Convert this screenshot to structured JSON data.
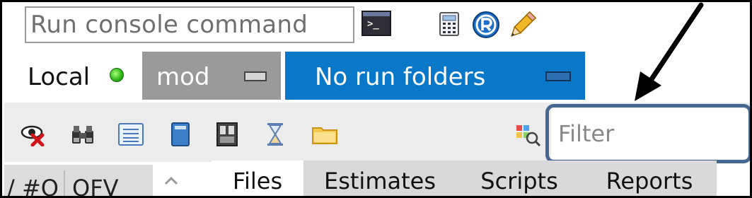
{
  "console": {
    "placeholder": "Run console command"
  },
  "header": {
    "status_label": "Local"
  },
  "mod_button": {
    "label": "mod"
  },
  "run_folders_button": {
    "label": "No run folders"
  },
  "filter": {
    "placeholder": "Filter"
  },
  "table": {
    "columns": [
      "/ #O",
      "OFV"
    ]
  },
  "tabs": [
    "Files",
    "Estimates",
    "Scripts",
    "Reports"
  ],
  "icons": {
    "row1": [
      "terminal-icon",
      "calculator-icon",
      "r-icon",
      "pencil-icon"
    ],
    "toolbar": [
      "hide-eye-icon",
      "binoculars-icon",
      "list-icon",
      "book-icon",
      "file-cabinet-icon",
      "hourglass-icon",
      "folder-icon"
    ],
    "filter": "filter-grid-icon"
  },
  "colors": {
    "accent": "#0a78c8",
    "mod_bg": "#9a9a9a",
    "status_green": "#29b314",
    "highlight": "#466890"
  }
}
